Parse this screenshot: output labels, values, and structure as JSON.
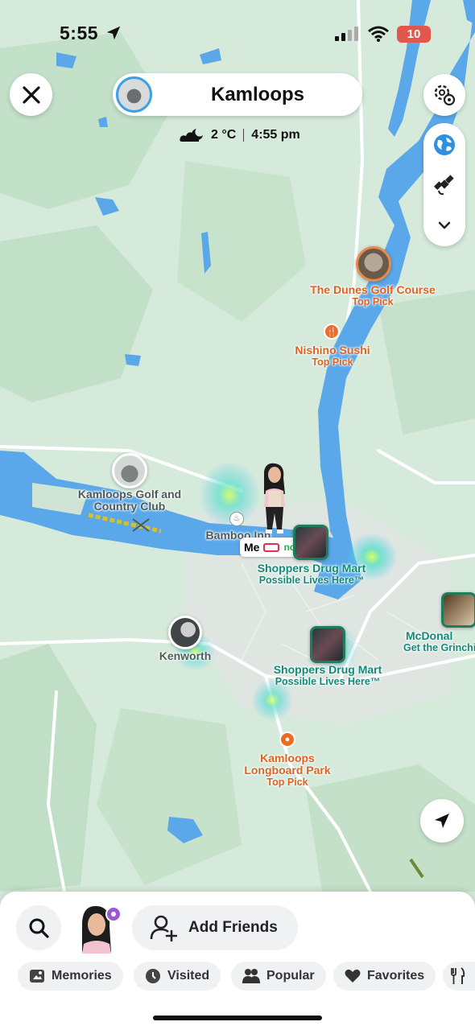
{
  "status_bar": {
    "time": "5:55",
    "battery": "10"
  },
  "header": {
    "location_title": "Kamloops",
    "temperature": "2 °C",
    "local_time": "4:55 pm"
  },
  "icons": {
    "close": "close-icon",
    "settings": "settings-gear-icon",
    "globe": "globe-icon",
    "satellite": "satellite-icon",
    "chevron": "chevron-down-icon",
    "locate": "location-arrow-icon",
    "search": "search-icon",
    "add_friend": "add-friend-icon"
  },
  "map": {
    "places": [
      {
        "name": "The Dunes Golf Course",
        "sub": "Top Pick"
      },
      {
        "name": "Nishino Sushi",
        "sub": "Top Pick"
      },
      {
        "name": "Kamloops Golf and Country Club"
      },
      {
        "name": "Bamboo Inn"
      },
      {
        "name": "Shoppers Drug Mart",
        "sub": "Possible Lives Here™"
      },
      {
        "name": "Kenworth"
      },
      {
        "name": "Shoppers Drug Mart",
        "sub": "Possible Lives Here™"
      },
      {
        "name": "McDonal",
        "sub": "Get the Grinchi"
      },
      {
        "name": "Kamloops Longboard Park",
        "sub": "Top Pick"
      }
    ],
    "me_label": "Me",
    "me_status": "now"
  },
  "bottom": {
    "add_friends_label": "Add Friends",
    "chips": [
      {
        "label": "Memories",
        "icon": "memories-icon"
      },
      {
        "label": "Visited",
        "icon": "clock-icon"
      },
      {
        "label": "Popular",
        "icon": "people-icon"
      },
      {
        "label": "Favorites",
        "icon": "heart-icon"
      },
      {
        "label": "",
        "icon": "fork-knife-icon"
      }
    ]
  },
  "colors": {
    "land": "#cfe6d3",
    "water": "#5aa8ea",
    "accent_blue": "#3aa0e8",
    "poi_orange": "#e0621f",
    "poi_teal": "#138a78"
  }
}
